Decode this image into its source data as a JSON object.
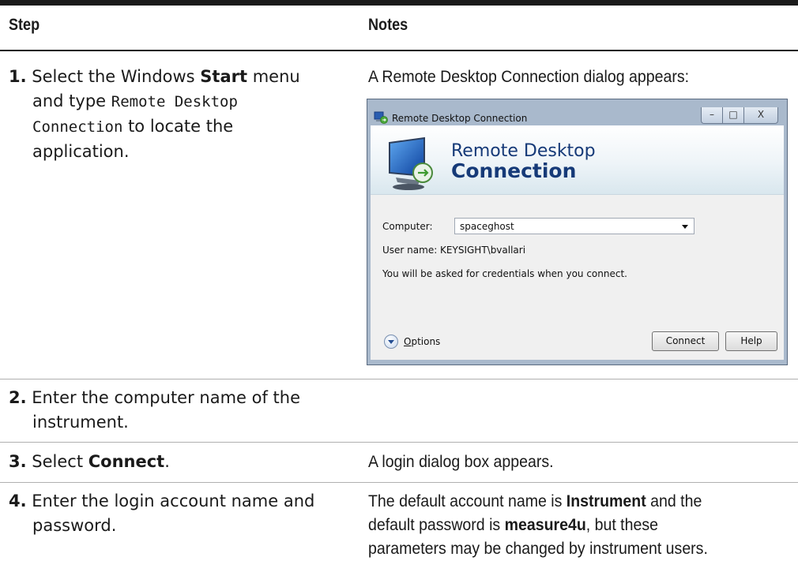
{
  "header": {
    "step": "Step",
    "notes": "Notes"
  },
  "rows": [
    {
      "num": "1.",
      "step_parts": [
        "Select the Windows ",
        "Start",
        " menu",
        "and type ",
        "Remote Desktop",
        "Connection",
        " to locate the",
        "application."
      ],
      "note": "A Remote Desktop Connection dialog appears:"
    },
    {
      "num": "2.",
      "step_line1": " Enter the computer name of the",
      "step_line2": "instrument."
    },
    {
      "num": "3.",
      "step_pre": " Select ",
      "step_bold": "Connect",
      "step_post": ".",
      "note": "A login dialog box appears."
    },
    {
      "num": "4.",
      "step_line1": " Enter the login account name and",
      "step_line2": "password.",
      "note_l1_pre": "The default account name is ",
      "note_l1_bold": "Instrument",
      "note_l1_post": " and the",
      "note_l2_pre": "default password is ",
      "note_l2_bold": "measure4u",
      "note_l2_post": ", but these",
      "note_l3": "parameters may be changed by instrument users."
    }
  ],
  "dialog": {
    "title": "Remote Desktop Connection",
    "banner_line1": "Remote Desktop",
    "banner_line2": "Connection",
    "computer_label": "Computer:",
    "computer_value": "spaceghost",
    "username_text": "User name:  KEYSIGHT\\bvallari",
    "credentials_text": "You will be asked for credentials when you connect.",
    "options_first": "O",
    "options_rest": "ptions",
    "connect_label": "Connect",
    "help_label": "Help",
    "minimize_glyph": "–",
    "maximize_glyph": "□",
    "close_glyph": "X"
  }
}
